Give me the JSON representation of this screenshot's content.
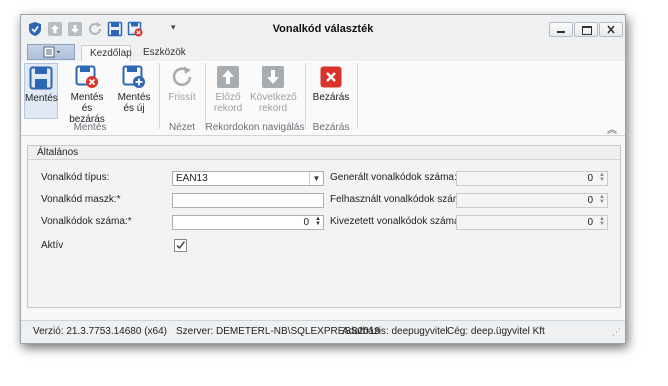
{
  "window": {
    "title": "Vonalkód választék"
  },
  "tabs": {
    "home": "Kezdőlap",
    "tools": "Eszközök"
  },
  "ribbon": {
    "save": "Mentés",
    "save_close_l1": "Mentés és",
    "save_close_l2": "bezárás",
    "save_new_l1": "Mentés",
    "save_new_l2": "és új",
    "refresh": "Frissít",
    "prev_l1": "Előző",
    "prev_l2": "rekord",
    "next_l1": "Következő",
    "next_l2": "rekord",
    "close": "Bezárás",
    "group_save": "Mentés",
    "group_view": "Nézet",
    "group_nav": "Rekordokon navigálás",
    "group_close": "Bezárás"
  },
  "form": {
    "section": "Általános",
    "type_label": "Vonalkód típus:",
    "type_value": "EAN13",
    "mask_label": "Vonalkód maszk:*",
    "mask_value": "",
    "count_label": "Vonalkódok száma:*",
    "count_value": "0",
    "active_label": "Aktív",
    "generated_label": "Generált vonalkódok száma:",
    "generated_value": "0",
    "used_label": "Felhasznált vonalkódok száma:",
    "used_value": "0",
    "issued_label": "Kivezetett vonalkódok száma:",
    "issued_value": "0"
  },
  "status": {
    "version": "Verzió: 21.3.7753.14680 (x64)",
    "server": "Szerver: DEMETERL-NB\\SQLEXPRESS2019",
    "database": "Adatbázis: deepugyvitel",
    "company": "Cég: deep.ügyvitel Kft"
  },
  "colors": {
    "accent_blue": "#2d66b3",
    "close_red": "#d9342b",
    "disabled_gray": "#a7acb1"
  }
}
